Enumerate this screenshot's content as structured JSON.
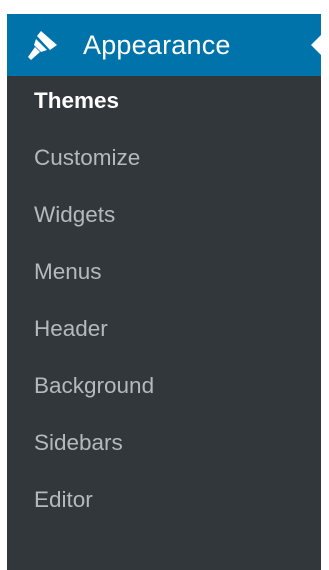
{
  "menu": {
    "title": "Appearance",
    "icon": "paintbrush-icon",
    "header_bg": "#0073aa",
    "menu_bg": "#32373c",
    "items": [
      {
        "label": "Themes",
        "current": true
      },
      {
        "label": "Customize",
        "current": false
      },
      {
        "label": "Widgets",
        "current": false
      },
      {
        "label": "Menus",
        "current": false
      },
      {
        "label": "Header",
        "current": false
      },
      {
        "label": "Background",
        "current": false
      },
      {
        "label": "Sidebars",
        "current": false
      },
      {
        "label": "Editor",
        "current": false
      }
    ]
  }
}
